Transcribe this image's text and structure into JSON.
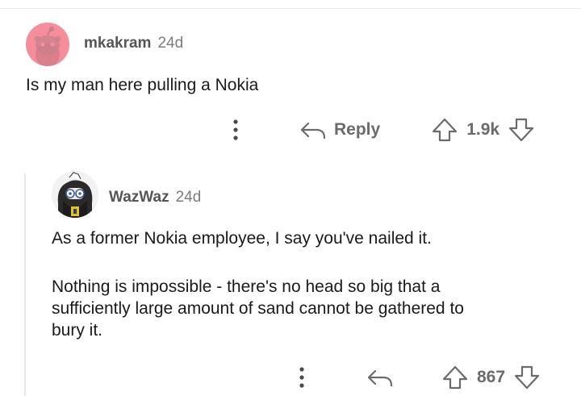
{
  "comment": {
    "author": "mkakram",
    "age": "24d",
    "body": "Is my man here pulling a Nokia",
    "reply_label": "Reply",
    "score": "1.9k"
  },
  "reply": {
    "author": "WazWaz",
    "age": "24d",
    "body": [
      "As a former Nokia employee, I say you've nailed it.",
      "Nothing is impossible - there's no head so big that a",
      "sufficiently large amount of sand cannot be gathered to",
      "bury it."
    ],
    "score": "867"
  },
  "icons": {
    "more": "more-vertical-icon",
    "reply": "reply-arrow-icon",
    "upvote": "upvote-arrow-icon",
    "downvote": "downvote-arrow-icon"
  },
  "colors": {
    "avatar_1": "#f58d9c",
    "meta_gray": "#7c7c7c",
    "action_gray": "#6b6b6b"
  }
}
